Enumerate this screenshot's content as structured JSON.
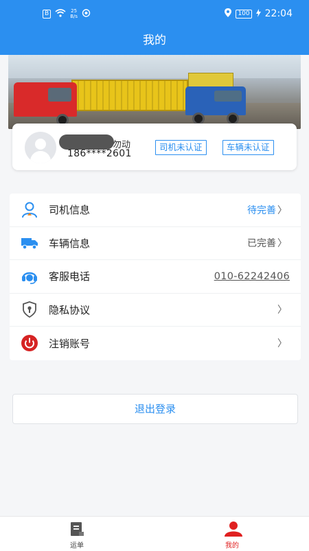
{
  "status_bar": {
    "speed_value": "25",
    "speed_unit": "B/s",
    "battery": "100",
    "time": "22:04"
  },
  "header": {
    "title": "我的"
  },
  "user": {
    "name_visible_suffix": "勿动",
    "phone": "186****2601",
    "driver_badge": "司机未认证",
    "vehicle_badge": "车辆未认证"
  },
  "menu": {
    "items": [
      {
        "label": "司机信息",
        "value": "待完善",
        "icon": "driver-icon"
      },
      {
        "label": "车辆信息",
        "value": "已完善",
        "icon": "truck-icon"
      },
      {
        "label": "客服电话",
        "value": "010-62242406",
        "icon": "customer-service-icon"
      },
      {
        "label": "隐私协议",
        "value": "",
        "icon": "shield-icon"
      },
      {
        "label": "注销账号",
        "value": "",
        "icon": "power-icon"
      }
    ]
  },
  "logout_label": "退出登录",
  "tabbar": {
    "tabs": [
      {
        "label": "运单",
        "icon": "waybill-icon",
        "active": false
      },
      {
        "label": "我的",
        "icon": "user-icon",
        "active": true
      }
    ]
  },
  "colors": {
    "primary": "#2b8ff0",
    "active_tab": "#e02020",
    "pending_text": "#2b8ff0"
  }
}
